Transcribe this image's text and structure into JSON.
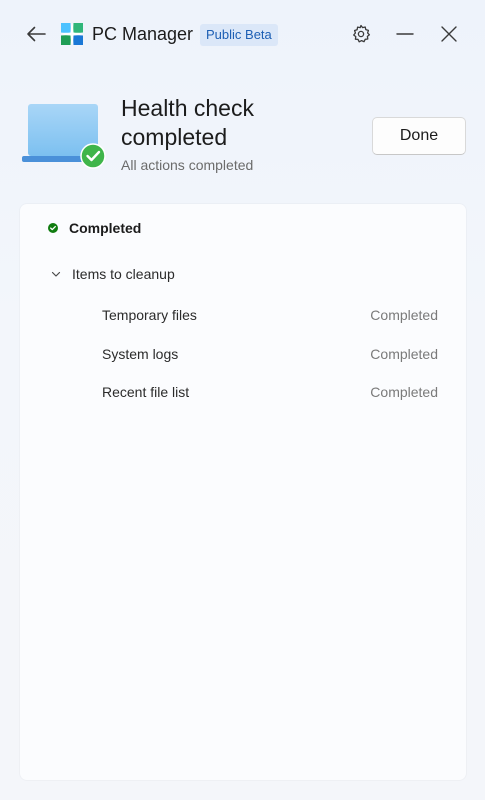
{
  "app": {
    "title": "PC Manager",
    "badge": "Public Beta"
  },
  "header": {
    "title": "Health check completed",
    "subtitle": "All actions completed",
    "done_label": "Done"
  },
  "results": {
    "status_label": "Completed",
    "status_color": "#107c10",
    "group": {
      "label": "Items to cleanup",
      "expanded": true,
      "items": [
        {
          "name": "Temporary files",
          "status": "Completed"
        },
        {
          "name": "System logs",
          "status": "Completed"
        },
        {
          "name": "Recent file list",
          "status": "Completed"
        }
      ]
    }
  },
  "colors": {
    "accent": "#1d5fb4",
    "success": "#2ea043"
  }
}
